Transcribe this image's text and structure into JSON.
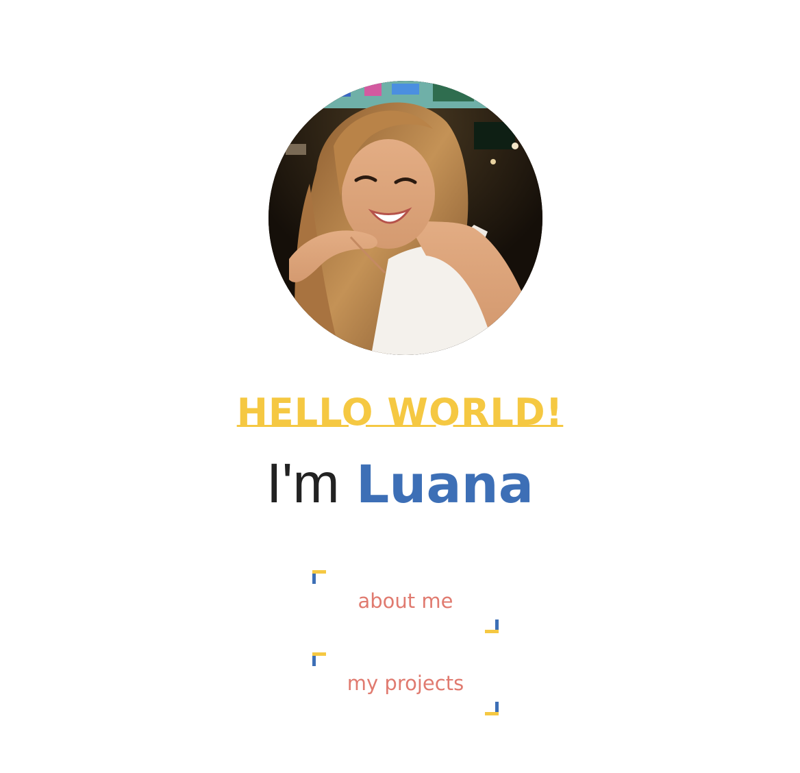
{
  "hero": {
    "greeting": "HELLO WORLD!",
    "intro_prefix": "I'm",
    "name": "Luana"
  },
  "nav": {
    "about_label": "about me",
    "projects_label": "my projects"
  },
  "colors": {
    "yellow": "#f5c842",
    "blue": "#3d6fb6",
    "coral": "#e07a6f"
  }
}
